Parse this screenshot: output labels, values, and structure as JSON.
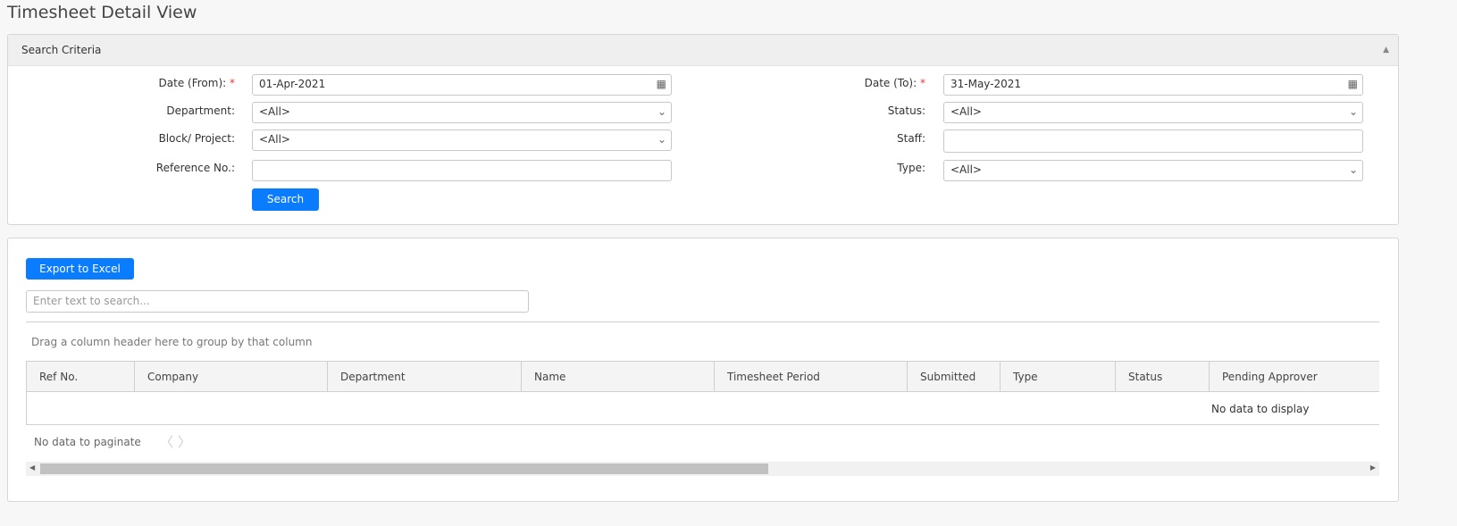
{
  "page": {
    "title": "Timesheet Detail View"
  },
  "search_panel": {
    "title": "Search Criteria",
    "fields": {
      "date_from": {
        "label": "Date (From):",
        "required": "*",
        "value": "01-Apr-2021"
      },
      "department": {
        "label": "Department:",
        "value": "<All>"
      },
      "block_project": {
        "label": "Block/ Project:",
        "value": "<All>"
      },
      "reference_no": {
        "label": "Reference No.:",
        "value": ""
      },
      "date_to": {
        "label": "Date (To):",
        "required": "*",
        "value": "31-May-2021"
      },
      "status": {
        "label": "Status:",
        "value": "<All>"
      },
      "staff": {
        "label": "Staff:",
        "value": ""
      },
      "type": {
        "label": "Type:",
        "value": "<All>"
      }
    },
    "search_label": "Search"
  },
  "grid": {
    "export_label": "Export to Excel",
    "search_placeholder": "Enter text to search...",
    "group_hint": "Drag a column header here to group by that column",
    "columns": [
      "Ref No.",
      "Company",
      "Department",
      "Name",
      "Timesheet Period",
      "Submitted",
      "Type",
      "Status",
      "Pending Approver"
    ],
    "empty_text": "No data to display",
    "pager_text": "No data to paginate"
  },
  "colors": {
    "accent": "#0a7cff",
    "required": "#e53935"
  }
}
